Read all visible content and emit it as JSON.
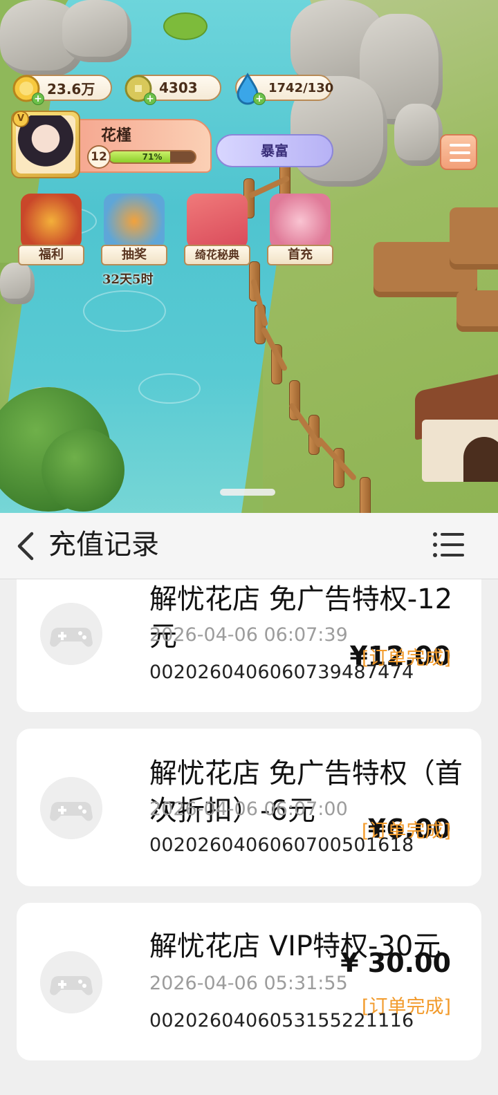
{
  "hud": {
    "gold": "23.6万",
    "jade": "4303",
    "water": "1742/130"
  },
  "profile": {
    "vip": "V",
    "name": "花槿",
    "level": "12",
    "xp_percent": "71%",
    "xp_fraction": 0.71
  },
  "rich_badge": "暴富",
  "events": [
    {
      "label": "福利",
      "icon": "gift-bag-icon"
    },
    {
      "label": "抽奖",
      "icon": "koi-fish-icon",
      "timer": "32天5时"
    },
    {
      "label": "绮花秘典",
      "icon": "flower-book-icon"
    },
    {
      "label": "首充",
      "icon": "rose-bouquet-icon"
    }
  ],
  "navbar": {
    "title": "充值记录",
    "back_icon": "chevron-left-icon",
    "menu_icon": "list-icon"
  },
  "records": [
    {
      "name": "解忧花店 免广告特权-12元",
      "time": "2026-04-06 06:07:39",
      "order": "0020260406060739487474",
      "amount": "¥12.00",
      "status": "[订单完成]"
    },
    {
      "name": "解忧花店 免广告特权（首次折扣）-6元",
      "time": "2026-04-06 06:07:00",
      "order": "0020260406060700501618",
      "amount": "¥6.00",
      "status": "[订单完成]"
    },
    {
      "name": "解忧花店 VIP特权-30元",
      "time": "2026-04-06 05:31:55",
      "order": "0020260406053155221116",
      "amount": "¥ 30.00",
      "status": "[订单完成]"
    }
  ],
  "colors": {
    "status": "#f29b2c",
    "time": "#9c9c9c",
    "panel_bg": "#efefef",
    "card_bg": "#ffffff"
  }
}
